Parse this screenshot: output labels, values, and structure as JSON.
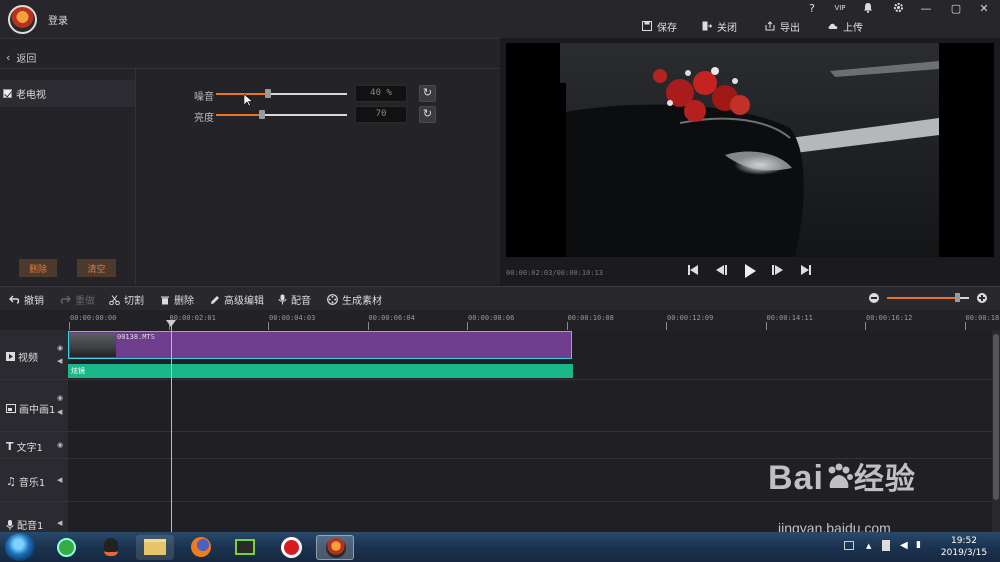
{
  "app": {
    "login_label": "登录",
    "window_controls": {
      "help": "?",
      "vip": "VIP",
      "notify": "bell-icon",
      "settings": "gear-icon",
      "minimize": "—",
      "restore": "▢",
      "close": "✕"
    },
    "top_actions": [
      {
        "name": "save",
        "label": "保存"
      },
      {
        "name": "close",
        "label": "关闭"
      },
      {
        "name": "export",
        "label": "导出"
      },
      {
        "name": "upload",
        "label": "上传"
      }
    ]
  },
  "effects_panel": {
    "back_label": "返回",
    "effect_item": "老电视",
    "effect_checked": true,
    "delete_label": "删除",
    "clear_label": "清空",
    "sliders": [
      {
        "name": "noise",
        "label": "噪音",
        "value_text": "40 %",
        "percent": 0.4,
        "reset": "↻"
      },
      {
        "name": "brightness",
        "label": "亮度",
        "value_text": "70",
        "percent": 0.35,
        "reset": "↻"
      }
    ]
  },
  "preview": {
    "timecode": "00:00:02:03/00:00:10:13",
    "controls": [
      "skip-start-icon",
      "step-back-icon",
      "play-icon",
      "step-forward-icon",
      "skip-end-icon"
    ]
  },
  "toolbar": {
    "items": [
      {
        "name": "undo",
        "label": "撤销",
        "enabled": true
      },
      {
        "name": "redo",
        "label": "重做",
        "enabled": false
      },
      {
        "name": "cut",
        "label": "切割",
        "enabled": true
      },
      {
        "name": "delete",
        "label": "删除",
        "enabled": true
      },
      {
        "name": "advanced-edit",
        "label": "高级编辑",
        "enabled": true
      },
      {
        "name": "dub",
        "label": "配音",
        "enabled": true
      },
      {
        "name": "generate",
        "label": "生成素材",
        "enabled": true
      }
    ],
    "zoom_level": 0.85
  },
  "timeline": {
    "ruler_ticks": [
      "00:00:00:00",
      "00:00:02:01",
      "00:00:04:03",
      "00:00:06:04",
      "00:00:08:06",
      "00:00:10:08",
      "00:00:12:09",
      "00:00:14:11",
      "00:00:16:12",
      "00:00:18:"
    ],
    "tracks": [
      {
        "name": "video",
        "label": "视频",
        "icon": "play-icon"
      },
      {
        "name": "pip",
        "label": "画中画1",
        "icon": "pip-icon"
      },
      {
        "name": "text",
        "label": "文字1",
        "icon": "text-icon"
      },
      {
        "name": "music",
        "label": "音乐1",
        "icon": "music-icon"
      },
      {
        "name": "voice",
        "label": "配音1",
        "icon": "mic-icon"
      }
    ],
    "clip_name": "00138.MTS",
    "effect_bar_label": "炫镜"
  },
  "taskbar": {
    "time": "19:52",
    "date": "2019/3/15"
  },
  "watermark": {
    "text": "Bai",
    "text2": "经验",
    "url": "jingyan.baidu.com"
  }
}
